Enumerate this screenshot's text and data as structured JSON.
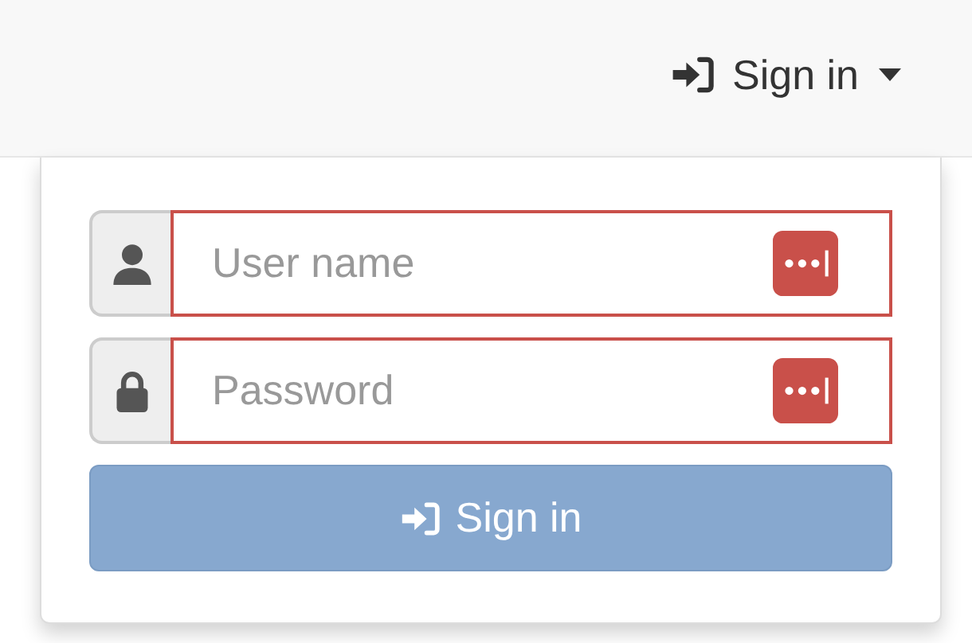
{
  "navbar": {
    "menu": {
      "label": "Sign in",
      "expanded": true
    }
  },
  "form": {
    "fields": [
      {
        "kind": "user",
        "placeholder": "User name",
        "autofill": true
      },
      {
        "kind": "password",
        "placeholder": "Password",
        "autofill": true
      }
    ],
    "submit": {
      "label": "Sign in",
      "disabled": true
    }
  }
}
